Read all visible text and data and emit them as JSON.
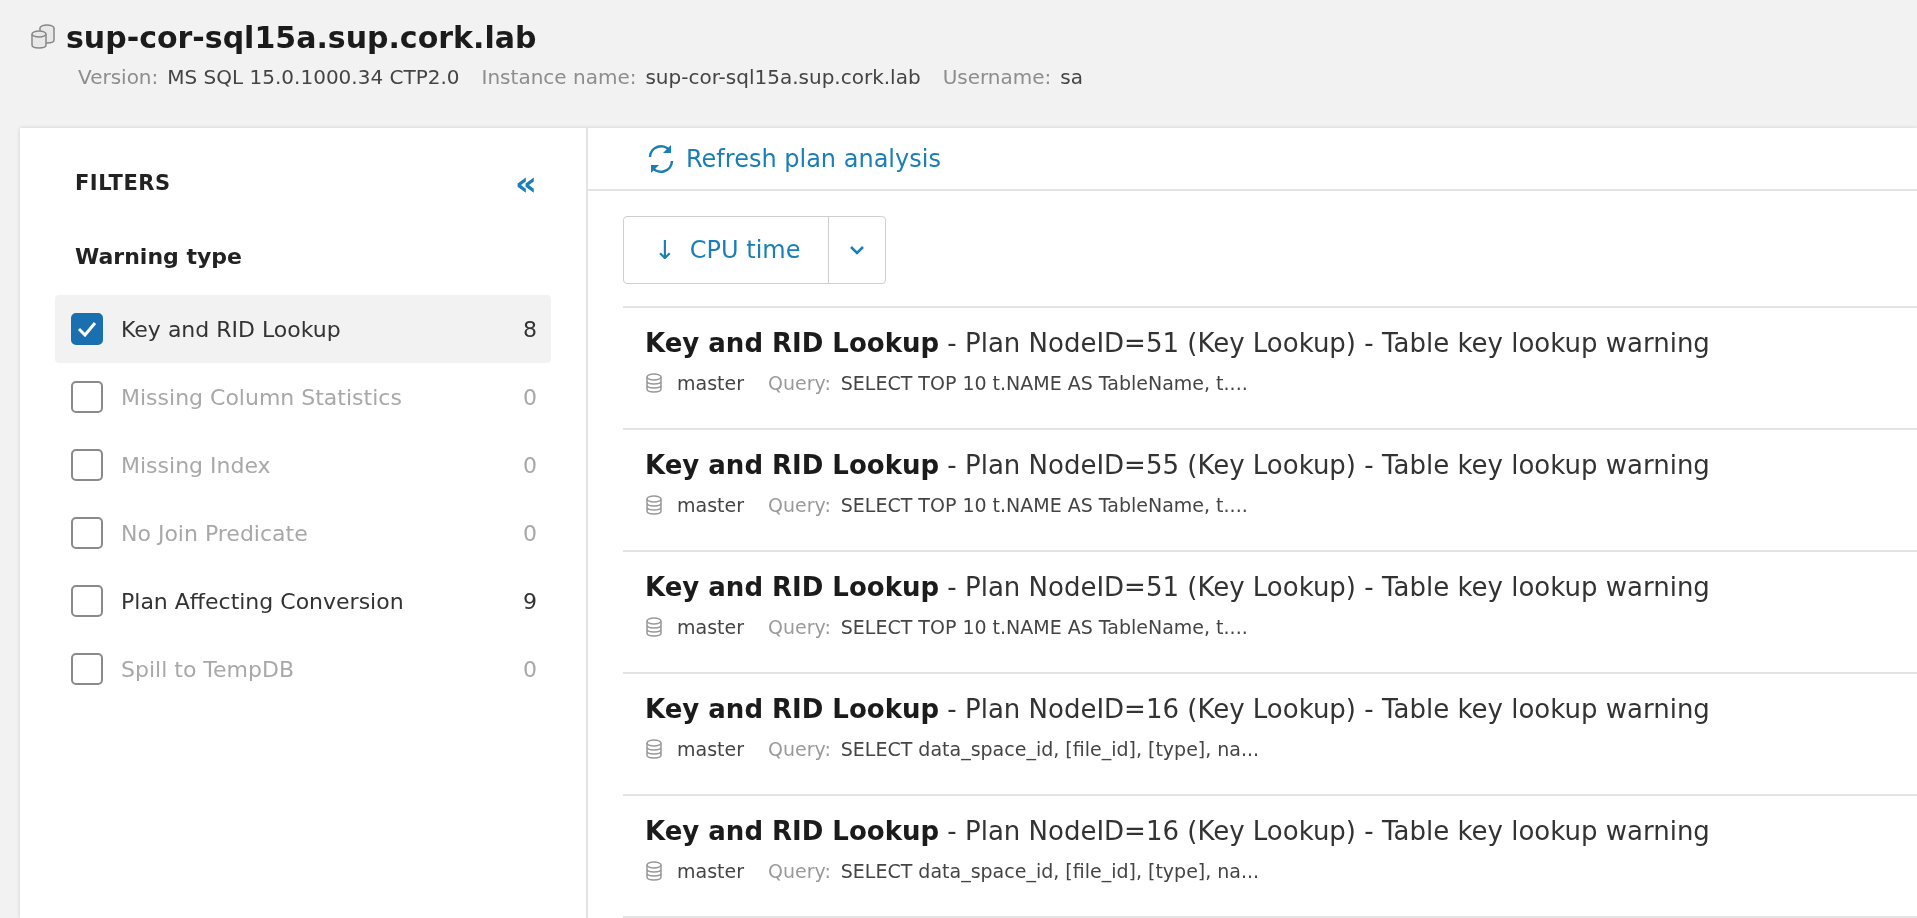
{
  "header": {
    "title": "sup-cor-sql15a.sup.cork.lab",
    "meta": [
      {
        "label": "Version:",
        "value": "MS SQL 15.0.1000.34 CTP2.0"
      },
      {
        "label": "Instance name:",
        "value": "sup-cor-sql15a.sup.cork.lab"
      },
      {
        "label": "Username:",
        "value": "sa"
      }
    ]
  },
  "filters": {
    "title": "FILTERS",
    "collapse": "«",
    "group": "Warning type",
    "items": [
      {
        "label": "Key and RID Lookup",
        "count": "8",
        "checked": true,
        "disabled": false,
        "selected": true
      },
      {
        "label": "Missing Column Statistics",
        "count": "0",
        "checked": false,
        "disabled": true,
        "selected": false
      },
      {
        "label": "Missing Index",
        "count": "0",
        "checked": false,
        "disabled": true,
        "selected": false
      },
      {
        "label": "No Join Predicate",
        "count": "0",
        "checked": false,
        "disabled": true,
        "selected": false
      },
      {
        "label": "Plan Affecting Conversion",
        "count": "9",
        "checked": false,
        "disabled": false,
        "selected": false
      },
      {
        "label": "Spill to TempDB",
        "count": "0",
        "checked": false,
        "disabled": true,
        "selected": false
      }
    ]
  },
  "toolbar": {
    "refresh": "Refresh plan analysis"
  },
  "sort": {
    "arrow": "↓",
    "label": "CPU time"
  },
  "warnings": [
    {
      "type": "Key and RID Lookup",
      "detail": " - Plan NodeID=51 (Key Lookup) - Table key lookup warning",
      "database": "master",
      "query_label": "Query:",
      "query": "SELECT TOP 10 t.NAME AS TableName, t...."
    },
    {
      "type": "Key and RID Lookup",
      "detail": " - Plan NodeID=55 (Key Lookup) - Table key lookup warning",
      "database": "master",
      "query_label": "Query:",
      "query": "SELECT TOP 10 t.NAME AS TableName, t...."
    },
    {
      "type": "Key and RID Lookup",
      "detail": " - Plan NodeID=51 (Key Lookup) - Table key lookup warning",
      "database": "master",
      "query_label": "Query:",
      "query": "SELECT TOP 10 t.NAME AS TableName, t...."
    },
    {
      "type": "Key and RID Lookup",
      "detail": " - Plan NodeID=16 (Key Lookup) - Table key lookup warning",
      "database": "master",
      "query_label": "Query:",
      "query": "SELECT data_space_id, [file_id], [type], na..."
    },
    {
      "type": "Key and RID Lookup",
      "detail": " - Plan NodeID=16 (Key Lookup) - Table key lookup warning",
      "database": "master",
      "query_label": "Query:",
      "query": "SELECT data_space_id, [file_id], [type], na..."
    }
  ]
}
